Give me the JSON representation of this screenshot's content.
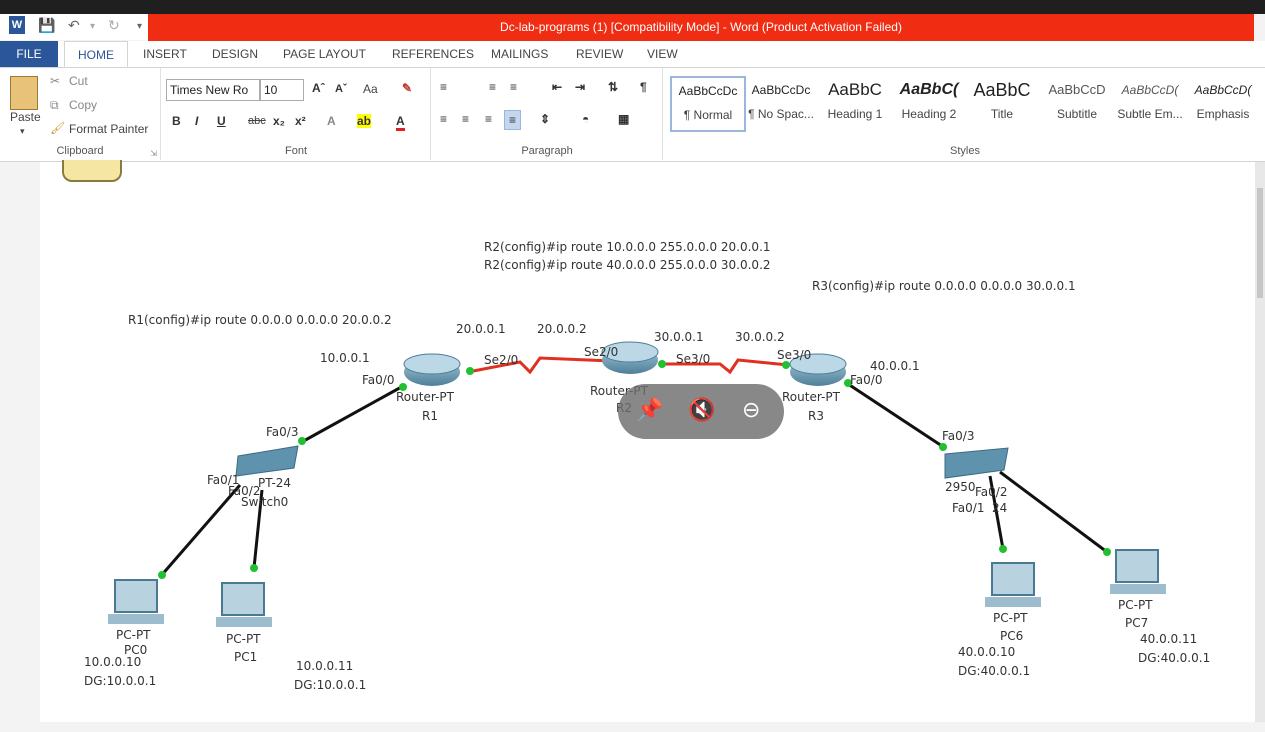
{
  "window": {
    "title": "Dc-lab-programs (1) [Compatibility Mode] -  Word (Product Activation Failed)"
  },
  "qat": {
    "word_icon": "word-app-icon",
    "save_icon": "save-icon",
    "undo_icon": "undo-icon",
    "redo_icon": "redo-icon"
  },
  "tabs": [
    "FILE",
    "HOME",
    "INSERT",
    "DESIGN",
    "PAGE LAYOUT",
    "REFERENCES",
    "MAILINGS",
    "REVIEW",
    "VIEW"
  ],
  "ribbon": {
    "clipboard": {
      "paste": "Paste",
      "cut": "Cut",
      "copy": "Copy",
      "format_painter": "Format Painter",
      "label": "Clipboard"
    },
    "font": {
      "name": "Times New Ro",
      "size": "10",
      "case": "Aa",
      "label": "Font"
    },
    "paragraph": {
      "label": "Paragraph"
    },
    "styles": {
      "label": "Styles",
      "items": [
        {
          "preview": "AaBbCcDc",
          "name": "¶ Normal"
        },
        {
          "preview": "AaBbCcDc",
          "name": "¶ No Spac..."
        },
        {
          "preview": "AaBbC",
          "name": "Heading 1"
        },
        {
          "preview": "AaBbC(",
          "name": "Heading 2"
        },
        {
          "preview": "AaBbC",
          "name": "Title"
        },
        {
          "preview": "AaBbCcD",
          "name": "Subtitle"
        },
        {
          "preview": "AaBbCcD(",
          "name": "Subtle Em..."
        },
        {
          "preview": "AaBbCcD(",
          "name": "Emphasis"
        }
      ]
    }
  },
  "diagram": {
    "cmd_r2_1": "R2(config)#ip route 10.0.0.0 255.0.0.0 20.0.0.1",
    "cmd_r2_2": "R2(config)#ip route 40.0.0.0 255.0.0.0 30.0.0.2",
    "cmd_r3": "R3(config)#ip route 0.0.0.0 0.0.0.0 30.0.0.1",
    "cmd_r1": "R1(config)#ip route 0.0.0.0 0.0.0.0 20.0.0.2",
    "ip_r1_se": "20.0.0.1",
    "ip_r2_se_left": "20.0.0.2",
    "ip_r2_se_right": "30.0.0.1",
    "ip_r3_se": "30.0.0.2",
    "ip_r1_fa": "10.0.0.1",
    "ip_r3_fa": "40.0.0.1",
    "r1_fa_port": "Fa0/0",
    "r1_se_port": "Se2/0",
    "r2_se_left_port": "Se2/0",
    "r2_se_right_port": "Se3/0",
    "r3_se_port": "Se3/0",
    "r3_fa_port": "Fa0/0",
    "r1_type": "Router-PT",
    "r1_name": "R1",
    "r2_type": "Router-PT",
    "r2_name": "R2",
    "r3_type": "Router-PT",
    "r3_name": "R3",
    "sw0_fa3": "Fa0/3",
    "sw0_fa1": "Fa0/1",
    "sw0_fa2": "Fa0/2",
    "sw0_model": "PT-24",
    "sw0_name": "Switch0",
    "sw1_fa3": "Fa0/3",
    "sw1_model": "2950",
    "sw1_fa2": "Fa0/2",
    "sw1_fa1": "Fa0/1",
    "sw1_suffix": "24",
    "pc0_type": "PC-PT",
    "pc0_name": "PC0",
    "pc0_ip": "10.0.0.10",
    "pc0_dg": "DG:10.0.0.1",
    "pc1_type": "PC-PT",
    "pc1_name": "PC1",
    "pc1_ip": "10.0.0.11",
    "pc1_dg": "DG:10.0.0.1",
    "pc6_type": "PC-PT",
    "pc6_name": "PC6",
    "pc6_ip": "40.0.0.10",
    "pc6_dg": "DG:40.0.0.1",
    "pc7_type": "PC-PT",
    "pc7_name": "PC7",
    "pc7_ip": "40.0.0.11",
    "pc7_dg": "DG:40.0.0.1"
  },
  "overlay": {
    "pin_icon": "pin-icon",
    "mute_icon": "mute-icon",
    "minimize_icon": "minimize-icon"
  }
}
